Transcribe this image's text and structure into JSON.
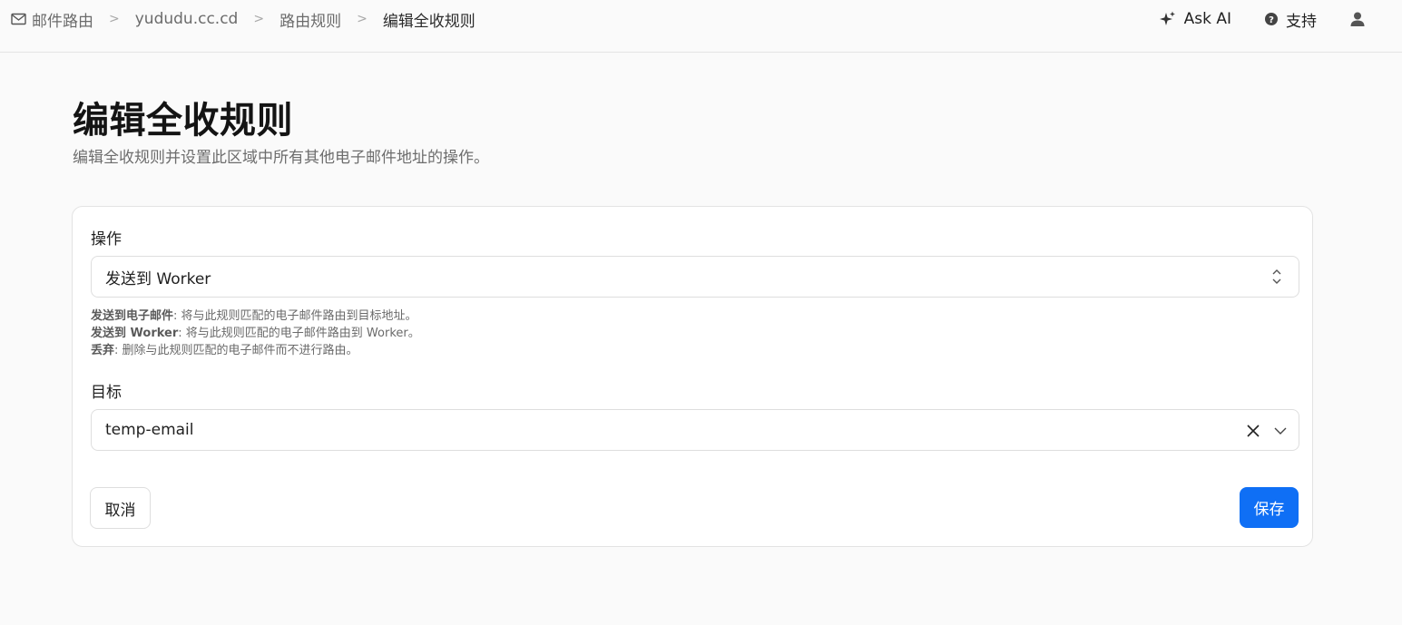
{
  "breadcrumb": {
    "items": [
      {
        "label": "邮件路由",
        "icon": "mail-icon"
      },
      {
        "label": "yududu.cc.cd"
      },
      {
        "label": "路由规则"
      },
      {
        "label": "编辑全收规则"
      }
    ],
    "separator": ">"
  },
  "topbar": {
    "ask_ai": {
      "label": "Ask AI",
      "icon": "sparkle-icon"
    },
    "support": {
      "label": "支持",
      "icon": "help-circle-icon"
    },
    "user": {
      "icon": "user-icon"
    }
  },
  "page": {
    "title": "编辑全收规则",
    "subtitle": "编辑全收规则并设置此区域中所有其他电子邮件地址的操作。"
  },
  "form": {
    "action": {
      "label": "操作",
      "value": "发送到 Worker",
      "help": [
        {
          "term": "发送到电子邮件",
          "desc": ": 将与此规则匹配的电子邮件路由到目标地址。"
        },
        {
          "term": "发送到 Worker",
          "desc": ": 将与此规则匹配的电子邮件路由到 Worker。"
        },
        {
          "term": "丢弃",
          "desc": ": 删除与此规则匹配的电子邮件而不进行路由。"
        }
      ]
    },
    "target": {
      "label": "目标",
      "value": "temp-email"
    },
    "cancel_label": "取消",
    "save_label": "保存"
  },
  "colors": {
    "primary": "#0f6ff5",
    "background": "#fafafa"
  }
}
